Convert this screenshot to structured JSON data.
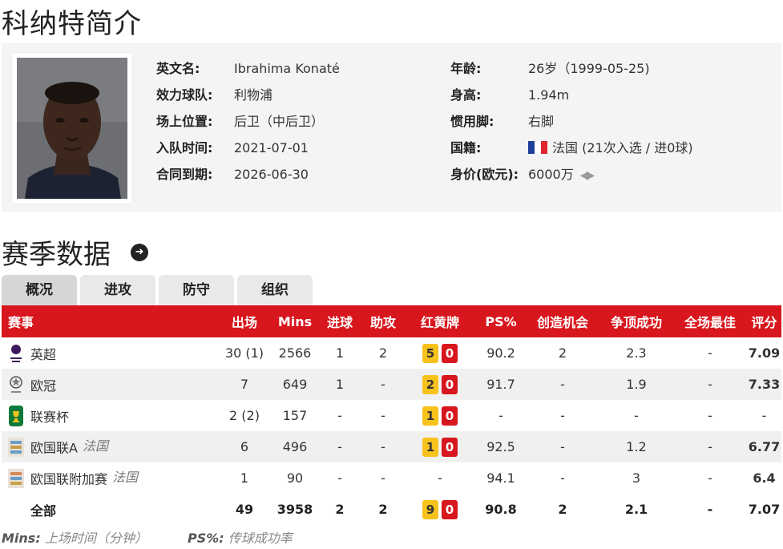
{
  "page_title": "科纳特简介",
  "profile": {
    "left": [
      {
        "label": "英文名:",
        "value": "Ibrahima Konaté"
      },
      {
        "label": "效力球队:",
        "value": "利物浦"
      },
      {
        "label": "场上位置:",
        "value": "后卫（中后卫）"
      },
      {
        "label": "入队时间:",
        "value": "2021-07-01"
      },
      {
        "label": "合同到期:",
        "value": "2026-06-30"
      }
    ],
    "right": [
      {
        "label": "年龄:",
        "value": "26岁（1999-05-25)"
      },
      {
        "label": "身高:",
        "value": "1.94m"
      },
      {
        "label": "惯用脚:",
        "value": "右脚"
      },
      {
        "label": "国籍:",
        "value": "法国 (21次入选 / 进0球)"
      },
      {
        "label": "身价(欧元):",
        "value": "6000万"
      }
    ],
    "flag_colors": [
      "#1f3f9b",
      "#ffffff",
      "#e0262d"
    ],
    "icons": {
      "avatar": "player-photo",
      "trend": "trend-arrows-icon"
    }
  },
  "season": {
    "title": "赛季数据",
    "arrow_icon": "➜",
    "tabs": [
      "概况",
      "进攻",
      "防守",
      "组织"
    ],
    "columns": [
      "赛事",
      "出场",
      "Mins",
      "进球",
      "助攻",
      "红黄牌",
      "PS%",
      "创造机会",
      "争顶成功",
      "全场最佳",
      "评分"
    ],
    "rows": [
      {
        "icon": "premier-league-icon",
        "name": "英超",
        "sub": "",
        "apps": "30 (1)",
        "mins": "2566",
        "goals": "1",
        "assists": "2",
        "yellow": "5",
        "red": "0",
        "ps": "90.2",
        "chances": "2",
        "aerial": "2.3",
        "motm": "-",
        "rating": "7.09"
      },
      {
        "icon": "champions-league-icon",
        "name": "欧冠",
        "sub": "",
        "apps": "7",
        "mins": "649",
        "goals": "1",
        "assists": "-",
        "yellow": "2",
        "red": "0",
        "ps": "91.7",
        "chances": "-",
        "aerial": "1.9",
        "motm": "-",
        "rating": "7.33"
      },
      {
        "icon": "league-cup-icon",
        "name": "联赛杯",
        "sub": "",
        "apps": "2 (2)",
        "mins": "157",
        "goals": "-",
        "assists": "-",
        "yellow": "1",
        "red": "0",
        "ps": "-",
        "chances": "-",
        "aerial": "-",
        "motm": "-",
        "rating": "-"
      },
      {
        "icon": "nations-league-icon",
        "name": "欧国联A",
        "sub": "法国",
        "apps": "6",
        "mins": "496",
        "goals": "-",
        "assists": "-",
        "yellow": "1",
        "red": "0",
        "ps": "92.5",
        "chances": "-",
        "aerial": "1.2",
        "motm": "-",
        "rating": "6.77"
      },
      {
        "icon": "nations-league-playoff-icon",
        "name": "欧国联附加赛",
        "sub": "法国",
        "apps": "1",
        "mins": "90",
        "goals": "-",
        "assists": "-",
        "yellow": "",
        "red": "",
        "card_text": "-",
        "ps": "94.1",
        "chances": "-",
        "aerial": "3",
        "motm": "-",
        "rating": "6.4"
      }
    ],
    "total": {
      "name": "全部",
      "apps": "49",
      "mins": "3958",
      "goals": "2",
      "assists": "2",
      "yellow": "9",
      "red": "0",
      "ps": "90.8",
      "chances": "2",
      "aerial": "2.1",
      "motm": "-",
      "rating": "7.07"
    }
  },
  "footnote": {
    "mins_key": "Mins:",
    "mins_desc": "上场时间（分钟）",
    "ps_key": "PS%:",
    "ps_desc": "传球成功率"
  },
  "colors": {
    "header_red": "#d8161d",
    "rating_orange": "#e0640e",
    "yellow_card": "#f7c21b"
  }
}
